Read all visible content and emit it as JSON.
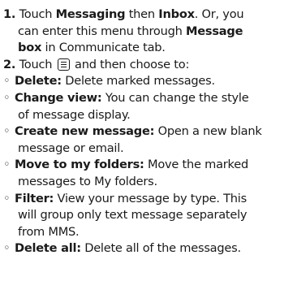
{
  "steps": [
    {
      "number": "1.",
      "parts": [
        {
          "t": " Touch ",
          "b": false
        },
        {
          "t": "Messaging",
          "b": true
        },
        {
          "t": " then ",
          "b": false
        },
        {
          "t": "Inbox",
          "b": true
        },
        {
          "t": ". Or, you",
          "b": false
        }
      ],
      "line2": [
        {
          "t": "can enter this menu through ",
          "b": false
        },
        {
          "t": "Message",
          "b": true
        }
      ],
      "line3": [
        {
          "t": "box",
          "b": true
        },
        {
          "t": " in Communicate tab.",
          "b": false
        }
      ]
    },
    {
      "number": "2.",
      "before_icon": " Touch ",
      "icon": "menu-icon",
      "after_icon": " and then choose to:"
    }
  ],
  "options": [
    {
      "term": "Delete:",
      "lines": [
        " Delete marked messages."
      ]
    },
    {
      "term": "Change view:",
      "lines": [
        " You can change the style",
        "of message display."
      ]
    },
    {
      "term": "Create new message:",
      "lines": [
        " Open a new blank",
        "message or email."
      ]
    },
    {
      "term": "Move to my folders:",
      "lines": [
        " Move the marked",
        "messages to My folders."
      ]
    },
    {
      "term": "Filter:",
      "lines": [
        " View your message by type. This",
        "will group only text message separately",
        "from MMS."
      ]
    },
    {
      "term": "Delete all:",
      "lines": [
        " Delete all of the messages."
      ]
    }
  ],
  "bullet_char": "◦"
}
